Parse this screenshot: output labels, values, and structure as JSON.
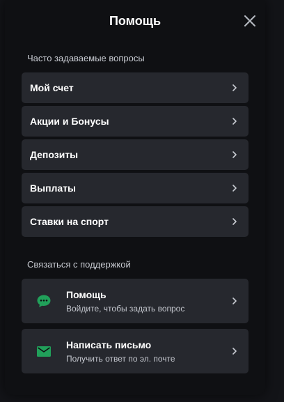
{
  "modal": {
    "title": "Помощь",
    "close_icon": "close-icon"
  },
  "faq": {
    "heading": "Часто задаваемые вопросы",
    "items": [
      {
        "label": "Мой счет"
      },
      {
        "label": "Акции и Бонусы"
      },
      {
        "label": "Депозиты"
      },
      {
        "label": "Выплаты"
      },
      {
        "label": "Ставки на спорт"
      }
    ]
  },
  "support": {
    "heading": "Связаться с поддержкой",
    "items": [
      {
        "title": "Помощь",
        "subtitle": "Войдите, чтобы задать вопрос",
        "icon": "chat-icon"
      },
      {
        "title": "Написать письмо",
        "subtitle": "Получить ответ по эл. почте",
        "icon": "mail-icon"
      }
    ]
  },
  "colors": {
    "accent_green": "#21a05a",
    "modal_bg": "#0f1013",
    "item_bg": "#26282e"
  }
}
